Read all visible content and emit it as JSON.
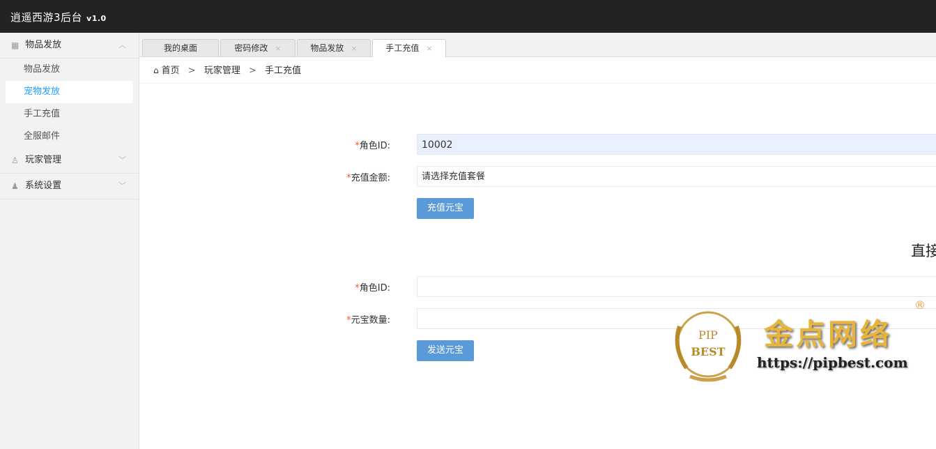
{
  "app": {
    "title": "逍遥西游3后台",
    "version": "v1.0"
  },
  "sidebar": {
    "groups": [
      {
        "label": "物品发放",
        "icon": "box-icon",
        "expanded": true,
        "items": [
          {
            "label": "物品发放"
          },
          {
            "label": "宠物发放",
            "active": true
          },
          {
            "label": "手工充值"
          },
          {
            "label": "全服邮件"
          }
        ]
      },
      {
        "label": "玩家管理",
        "icon": "user-outline-icon",
        "expanded": false
      },
      {
        "label": "系统设置",
        "icon": "user-solid-icon",
        "expanded": false
      }
    ]
  },
  "tabs": [
    {
      "label": "我的桌面",
      "closable": false
    },
    {
      "label": "密码修改",
      "close": "×"
    },
    {
      "label": "物品发放",
      "close": "×"
    },
    {
      "label": "手工充值",
      "close": "×",
      "active": true
    }
  ],
  "breadcrumb": {
    "home": "首页",
    "sep": ">",
    "level2": "玩家管理",
    "level3": "手工充值"
  },
  "form1": {
    "role_label": "角色ID:",
    "role_value": "10002",
    "amount_label": "充值金额:",
    "amount_value": "请选择充值套餐",
    "submit_label": "充值元宝"
  },
  "section_title": "直接",
  "form2": {
    "role_label": "角色ID:",
    "role_value": "",
    "ingot_label": "元宝数量:",
    "ingot_value": "",
    "submit_label": "发送元宝"
  },
  "required_mark": "*",
  "watermark": {
    "seal_text1": "PIP",
    "seal_text2": "BEST",
    "brand": "金点网络",
    "url": "https://pipbest.com",
    "registered": "®"
  },
  "colors": {
    "header": "#232323",
    "accent": "#1e9fff",
    "button": "#5b9ad8",
    "required": "#ff5722"
  }
}
